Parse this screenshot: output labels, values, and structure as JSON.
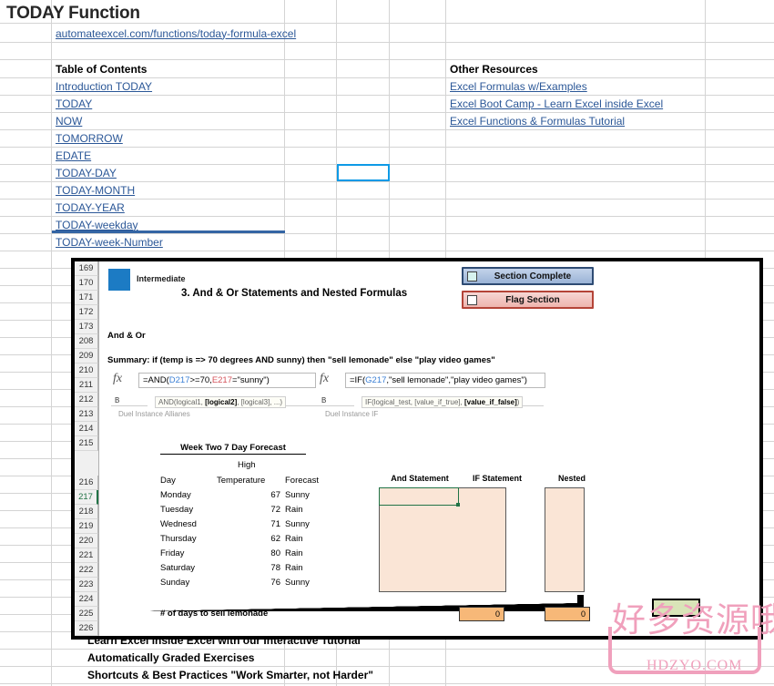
{
  "sheet": {
    "title": "TODAY Function",
    "url_link": "automateexcel.com/functions/today-formula-excel",
    "toc_heading": "Table of Contents",
    "toc_items": [
      "Introduction TODAY",
      "TODAY",
      "NOW",
      "TOMORROW",
      "EDATE",
      "TODAY-DAY",
      "TODAY-MONTH",
      "TODAY-YEAR",
      "TODAY-weekday",
      "TODAY-week-Number"
    ],
    "resources_heading": "Other Resources",
    "resources_items": [
      "Excel Formulas w/Examples",
      "Excel Boot Camp - Learn Excel inside Excel",
      "Excel Functions & Formulas Tutorial"
    ],
    "selected_cell_ref": ""
  },
  "embedded": {
    "row_numbers": [
      "169",
      "170",
      "171",
      "172",
      "173",
      "208",
      "209",
      "210",
      "211",
      "212",
      "213",
      "214",
      "215",
      "216",
      "217",
      "218",
      "219",
      "220",
      "221",
      "222",
      "223",
      "224",
      "225",
      "226"
    ],
    "selected_row": "217",
    "level_label": "Intermediate",
    "level_color": "#1c7bc4",
    "lesson_heading": "3. And & Or Statements and Nested Formulas",
    "section_label": "And & Or",
    "summary": "Summary: if (temp is => 70 degrees AND sunny) then \"sell lemonade\" else \"play video games\"",
    "buttons": {
      "section_complete": "Section Complete",
      "flag_section": "Flag Section",
      "complete_color": "#9ab3d6",
      "flag_color": "#eeb4ae"
    },
    "formula_left": {
      "fx": "fx",
      "prefix": "=AND(",
      "ref1": "D217",
      "mid": ">=70,",
      "ref2": "E217",
      "suffix": "=\"sunny\")",
      "col_header": "B",
      "tooltip_pre": "AND(logical1, ",
      "tooltip_bold": "[logical2]",
      "tooltip_post": ", [logical3], ...)",
      "ghost": "Duel  Instance   Allianes"
    },
    "formula_right": {
      "fx": "fx",
      "prefix": "=IF(",
      "ref1": "G217",
      "suffix": ",\"sell lemonade\",\"play video games\")",
      "col_header": "B",
      "tooltip_pre": "IF(logical_test, [value_if_true], ",
      "tooltip_bold": "[value_if_false]",
      "tooltip_post": ")",
      "ghost": "Duel  Instance   IF"
    },
    "forecast": {
      "title": "Week Two 7 Day Forecast",
      "sub_header": "High",
      "columns": [
        "Day",
        "Temperature",
        "Forecast"
      ],
      "rows": [
        [
          "Monday",
          "67",
          "Sunny"
        ],
        [
          "Tuesday",
          "72",
          "Rain"
        ],
        [
          "Wednesd",
          "71",
          "Sunny"
        ],
        [
          "Thursday",
          "62",
          "Rain"
        ],
        [
          "Friday",
          "80",
          "Rain"
        ],
        [
          "Saturday",
          "78",
          "Rain"
        ],
        [
          "Sunday",
          "76",
          "Sunny"
        ]
      ],
      "footer": "# of days to sell lemonade"
    },
    "statements": {
      "and_label": "And Statement",
      "if_label": "IF Statement",
      "nested_label": "Nested",
      "if_result": "0",
      "nested_result": "0",
      "box_color": "#fae5d6",
      "result_color": "#f7b878"
    }
  },
  "promo": [
    "Learn Excel inside Excel with our Interactive Tutorial",
    "Automatically Graded Exercises",
    "Shortcuts & Best Practices \"Work Smarter, not Harder\""
  ],
  "watermark": {
    "cjk": "好多资源哦",
    "domain": "HDZYO.COM",
    "color": "#f0a0bc"
  }
}
